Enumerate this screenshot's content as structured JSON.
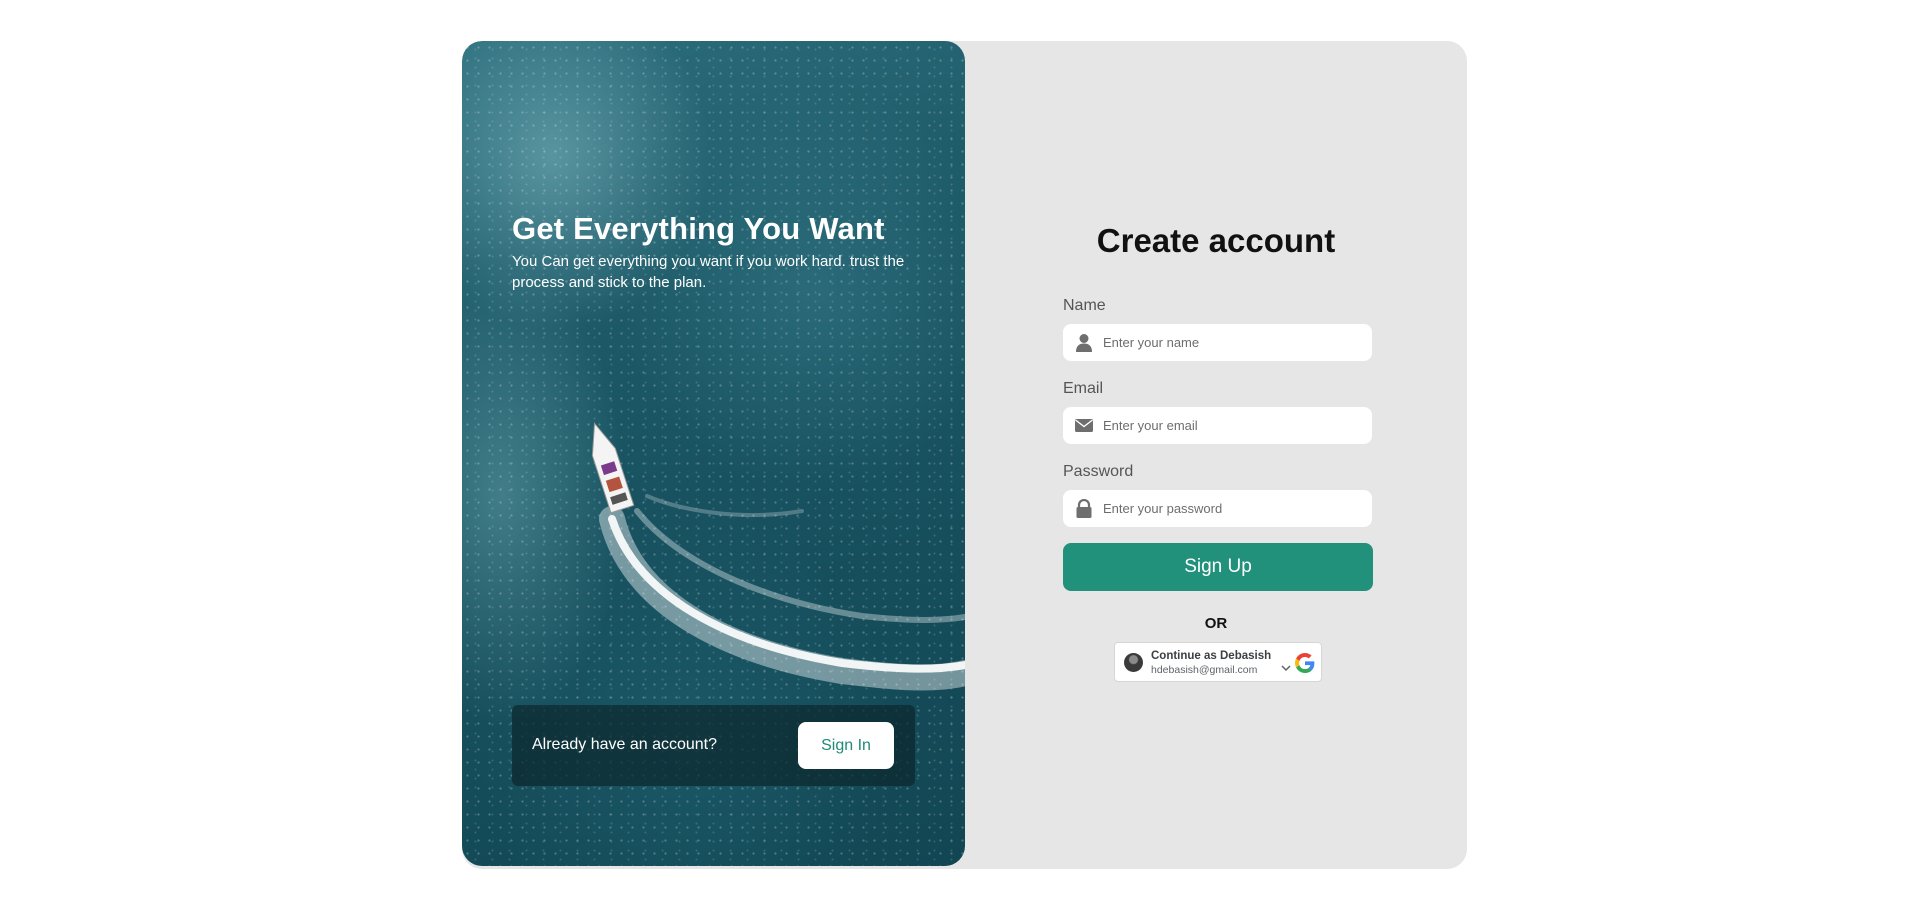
{
  "hero": {
    "title": "Get Everything You Want",
    "subtitle": "You Can get everything you want if you work hard. trust the process and stick to the plan.",
    "signin_prompt": "Already have an account?",
    "signin_label": "Sign In"
  },
  "form": {
    "title": "Create account",
    "name_label": "Name",
    "name_placeholder": "Enter your name",
    "email_label": "Email",
    "email_placeholder": "Enter your email",
    "password_label": "Password",
    "password_placeholder": "Enter your password",
    "signup_label": "Sign Up",
    "or_text": "OR"
  },
  "google": {
    "name": "Continue as Debasish",
    "email": "hdebasish@gmail.com"
  },
  "colors": {
    "accent": "#21917c",
    "signin_text": "#1f8a78",
    "panel_bg": "#e6e6e6"
  }
}
